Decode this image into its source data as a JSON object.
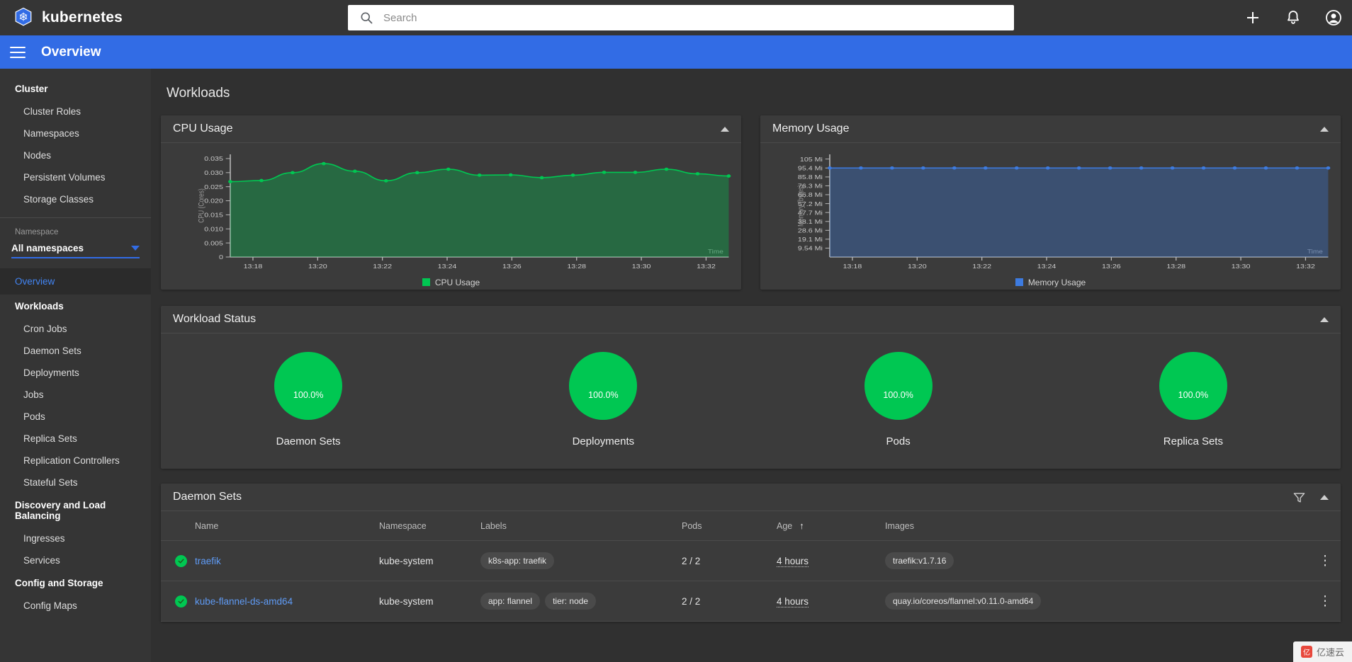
{
  "topbar": {
    "brand": "kubernetes",
    "search_placeholder": "Search",
    "search_value": "",
    "icons": [
      "search-icon",
      "plus-icon",
      "bell-icon",
      "account-icon"
    ]
  },
  "header": {
    "title": "Overview",
    "menu_icon": "hamburger-icon"
  },
  "sidebar": {
    "groups": [
      {
        "title": "Cluster",
        "items": [
          "Cluster Roles",
          "Namespaces",
          "Nodes",
          "Persistent Volumes",
          "Storage Classes"
        ]
      },
      {
        "title": "Workloads",
        "items": [
          "Cron Jobs",
          "Daemon Sets",
          "Deployments",
          "Jobs",
          "Pods",
          "Replica Sets",
          "Replication Controllers",
          "Stateful Sets"
        ]
      },
      {
        "title": "Discovery and Load Balancing",
        "items": [
          "Ingresses",
          "Services"
        ]
      },
      {
        "title": "Config and Storage",
        "items": [
          "Config Maps"
        ]
      }
    ],
    "namespace_label": "Namespace",
    "namespace_value": "All namespaces",
    "active_item": "Overview"
  },
  "main": {
    "section_title": "Workloads"
  },
  "chart_data": [
    {
      "type": "area",
      "title": "CPU Usage",
      "xlabel": "Time",
      "ylabel": "CPU (Cores)",
      "legend": "CPU Usage",
      "legend_position": "bottom",
      "color": "#00c752",
      "grid": false,
      "ylim": [
        0,
        0.0365
      ],
      "yticks": [
        "0",
        "0.005",
        "0.010",
        "0.015",
        "0.020",
        "0.025",
        "0.030",
        "0.035"
      ],
      "ytick_values": [
        0,
        0.005,
        0.01,
        0.015,
        0.02,
        0.025,
        0.03,
        0.035
      ],
      "xticks": [
        "13:18",
        "13:20",
        "13:22",
        "13:24",
        "13:26",
        "13:28",
        "13:30",
        "13:32"
      ],
      "x": [
        "13:17",
        "13:18",
        "13:19",
        "13:20",
        "13:21",
        "13:22",
        "13:23",
        "13:24",
        "13:25",
        "13:26",
        "13:27",
        "13:28",
        "13:29",
        "13:30",
        "13:31",
        "13:32"
      ],
      "values": [
        0.0268,
        0.0272,
        0.03,
        0.0332,
        0.0305,
        0.0271,
        0.03,
        0.0312,
        0.0291,
        0.0292,
        0.0282,
        0.0291,
        0.0301,
        0.0301,
        0.0312,
        0.0296,
        0.0288
      ]
    },
    {
      "type": "area",
      "title": "Memory Usage",
      "xlabel": "Time",
      "ylabel": "Memory (bytes)",
      "legend": "Memory Usage",
      "legend_position": "bottom",
      "color": "#3d7be0",
      "grid": false,
      "ylim": [
        0,
        110
      ],
      "yticks": [
        "105 Mi",
        "95.4 Mi",
        "85.8 Mi",
        "76.3 Mi",
        "66.8 Mi",
        "57.2 Mi",
        "47.7 Mi",
        "38.1 Mi",
        "28.6 Mi",
        "19.1 Mi",
        "9.54 Mi"
      ],
      "ytick_values": [
        105,
        95.4,
        85.8,
        76.3,
        66.8,
        57.2,
        47.7,
        38.1,
        28.6,
        19.1,
        9.54
      ],
      "xticks": [
        "13:18",
        "13:20",
        "13:22",
        "13:24",
        "13:26",
        "13:28",
        "13:30",
        "13:32"
      ],
      "x": [
        "13:17",
        "13:18",
        "13:19",
        "13:20",
        "13:21",
        "13:22",
        "13:23",
        "13:24",
        "13:25",
        "13:26",
        "13:27",
        "13:28",
        "13:29",
        "13:30",
        "13:31",
        "13:32"
      ],
      "values": [
        95.4,
        95.4,
        95.4,
        95.4,
        95.4,
        95.4,
        95.4,
        95.4,
        95.4,
        95.4,
        95.4,
        95.4,
        95.4,
        95.4,
        95.4,
        95.4,
        95.4
      ]
    }
  ],
  "workload_status": {
    "title": "Workload Status",
    "cells": [
      {
        "label": "Daemon Sets",
        "percent": "100.0%",
        "value": 100,
        "color": "#00c752"
      },
      {
        "label": "Deployments",
        "percent": "100.0%",
        "value": 100,
        "color": "#00c752"
      },
      {
        "label": "Pods",
        "percent": "100.0%",
        "value": 100,
        "color": "#00c752"
      },
      {
        "label": "Replica Sets",
        "percent": "100.0%",
        "value": 100,
        "color": "#00c752"
      }
    ]
  },
  "daemon_sets": {
    "title": "Daemon Sets",
    "columns": [
      "",
      "Name",
      "Namespace",
      "Labels",
      "Pods",
      "Age",
      "Images",
      ""
    ],
    "sorted_column": "Age",
    "sort_direction": "asc",
    "rows": [
      {
        "status": "ok",
        "name": "traefik",
        "namespace": "kube-system",
        "labels": [
          "k8s-app: traefik"
        ],
        "pods": "2 / 2",
        "age": "4 hours",
        "images": [
          "traefik:v1.7.16"
        ]
      },
      {
        "status": "ok",
        "name": "kube-flannel-ds-amd64",
        "namespace": "kube-system",
        "labels": [
          "app: flannel",
          "tier: node"
        ],
        "pods": "2 / 2",
        "age": "4 hours",
        "images": [
          "quay.io/coreos/flannel:v0.11.0-amd64"
        ]
      }
    ]
  },
  "watermark": {
    "badge": "亿",
    "text": "亿速云"
  }
}
